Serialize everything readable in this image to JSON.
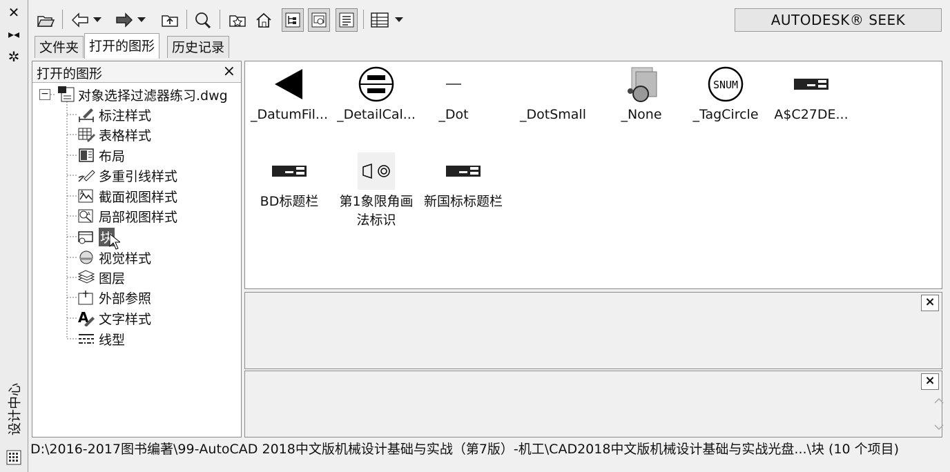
{
  "palette": {
    "title": "设计中心"
  },
  "toolbar": {
    "brand": "AUTODESK® SEEK",
    "buttons": [
      "load-icon",
      "back-icon",
      "back-dropdown-icon",
      "forward-icon",
      "forward-dropdown-icon",
      "up-icon",
      "search-icon",
      "favorites-icon",
      "home-icon",
      "tree-toggle-icon",
      "preview-icon",
      "description-icon",
      "views-icon",
      "views-dropdown-icon"
    ]
  },
  "tabs": [
    "文件夹",
    "打开的图形",
    "历史记录"
  ],
  "tree": {
    "header": "打开的图形",
    "close": "×",
    "root_toggle": "−",
    "root": "对象选择过滤器练习.dwg",
    "items": [
      {
        "label": "标注样式",
        "icon": "dimension-style-icon"
      },
      {
        "label": "表格样式",
        "icon": "table-style-icon"
      },
      {
        "label": "布局",
        "icon": "layout-icon"
      },
      {
        "label": "多重引线样式",
        "icon": "multileader-style-icon"
      },
      {
        "label": "截面视图样式",
        "icon": "section-view-style-icon"
      },
      {
        "label": "局部视图样式",
        "icon": "detail-view-style-icon"
      },
      {
        "label": "块",
        "icon": "block-icon",
        "selected": true
      },
      {
        "label": "视觉样式",
        "icon": "visual-style-icon"
      },
      {
        "label": "图层",
        "icon": "layer-icon"
      },
      {
        "label": "外部参照",
        "icon": "xref-icon"
      },
      {
        "label": "文字样式",
        "icon": "text-style-icon"
      },
      {
        "label": "线型",
        "icon": "linetype-icon"
      }
    ]
  },
  "content": {
    "items": [
      {
        "label": "_DatumFil...",
        "thumb": "datum-filled-arrow"
      },
      {
        "label": "_DetailCal...",
        "thumb": "detail-callout"
      },
      {
        "label": "_Dot",
        "thumb": "dot"
      },
      {
        "label": "_DotSmall",
        "thumb": "dot-small"
      },
      {
        "label": "_None",
        "thumb": "none-block"
      },
      {
        "label": "_TagCircle",
        "thumb": "tag-circle"
      },
      {
        "label": "A$C27DE...",
        "thumb": "title-block-mini"
      },
      {
        "label": "BD标题栏",
        "thumb": "title-block-mini"
      },
      {
        "label": "第1象限角画法标识",
        "thumb": "first-angle-symbol"
      },
      {
        "label": "新国标标题栏",
        "thumb": "title-block-mini"
      }
    ],
    "tag_text": "SNUM"
  },
  "preview": {
    "close": "×"
  },
  "description": {
    "close": "×"
  },
  "status": "D:\\2016-2017图书编著\\99-AutoCAD 2018中文版机械设计基础与实战（第7版）-机工\\CAD2018中文版机械设计基础与实战光盘...\\块 (10 个项目)"
}
